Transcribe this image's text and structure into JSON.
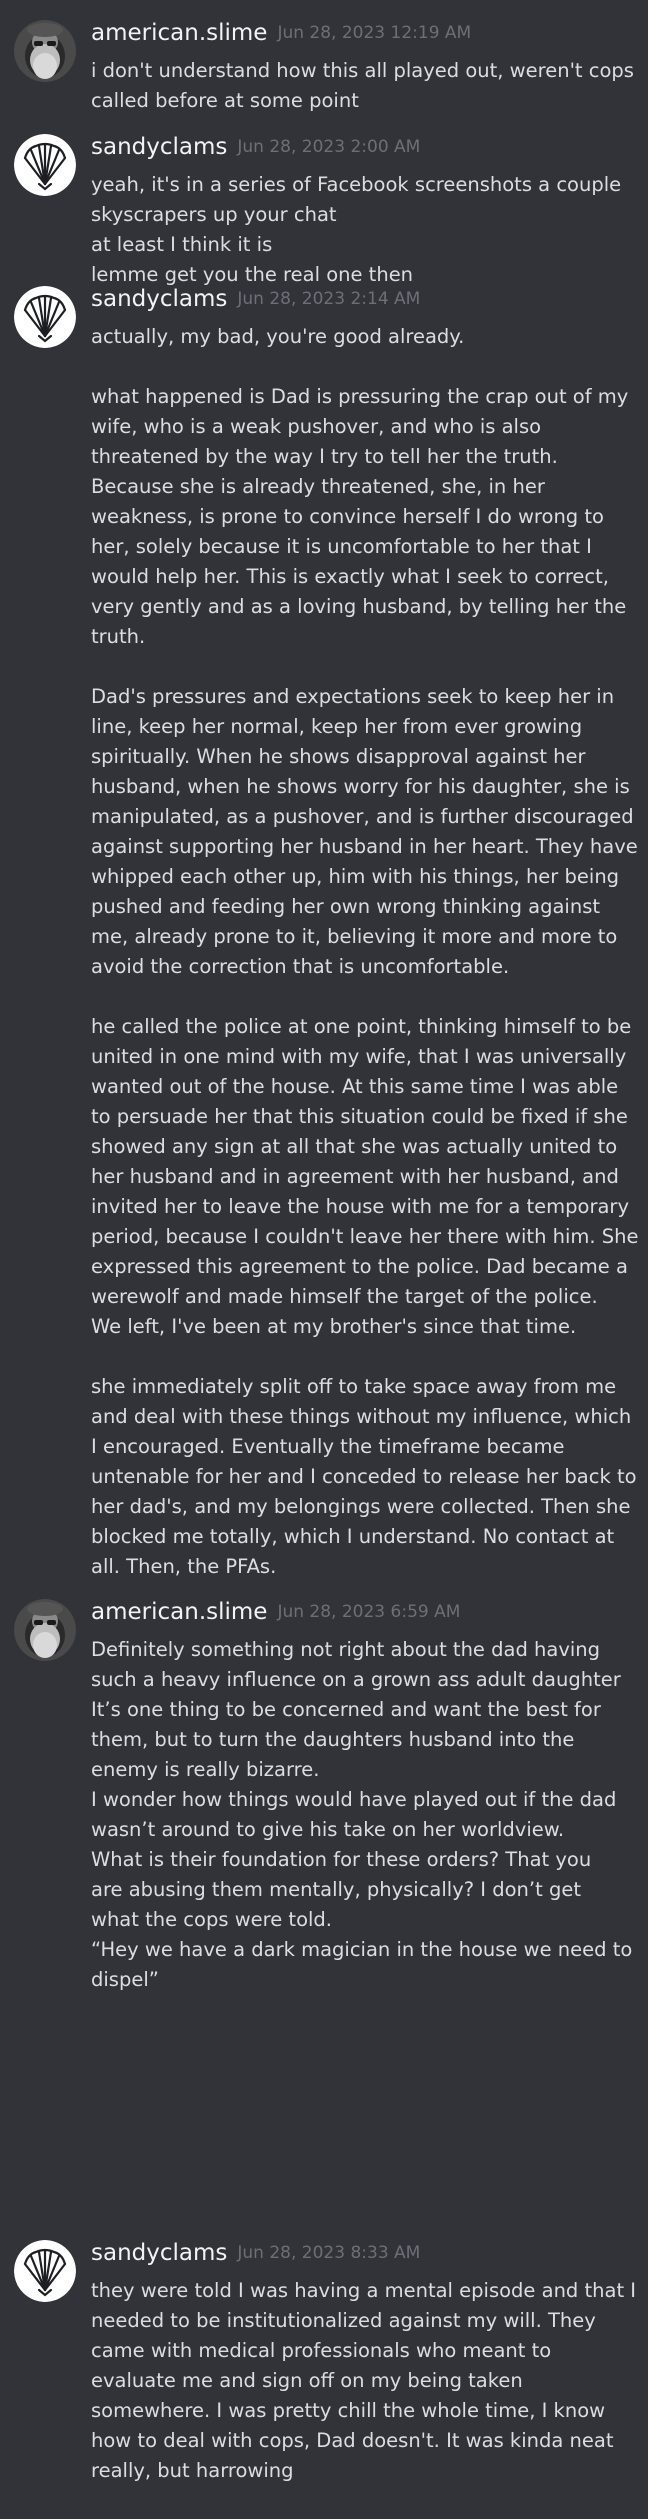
{
  "messages": [
    {
      "author": "american.slime",
      "avatar": "american-slime-avatar",
      "timestamp": "Jun 28, 2023 12:19 AM",
      "lines": [
        "i don't understand how this all played out, weren't cops",
        "called before at some point"
      ]
    },
    {
      "author": "sandyclams",
      "avatar": "shell-avatar",
      "timestamp": "Jun 28, 2023 2:00 AM",
      "lines": [
        "yeah, it's in a series of Facebook screenshots a couple",
        "skyscrapers up your chat",
        "at least I think it is",
        "lemme get you the real one then"
      ]
    },
    {
      "author": "sandyclams",
      "avatar": "shell-avatar",
      "timestamp": "Jun 28, 2023 2:14 AM",
      "lines": [
        "actually, my bad, you're good already.",
        "",
        "what happened is Dad is pressuring the crap out of my",
        "wife, who is a weak pushover, and who is also",
        "threatened by the way I try to tell her the truth.",
        "Because she is already threatened, she, in her",
        "weakness, is prone to convince herself I do wrong to",
        "her, solely because it is uncomfortable to her that I",
        "would help her. This is exactly what I seek to correct,",
        "very gently and as a loving husband, by telling her the",
        "truth.",
        "",
        "Dad's pressures and expectations seek to keep her in",
        "line, keep her normal, keep her from ever growing",
        "spiritually. When he shows disapproval against her",
        "husband, when he shows worry for his daughter, she is",
        "manipulated, as a pushover, and is further discouraged",
        "against supporting her husband in her heart. They have",
        "whipped each other up, him with his things, her being",
        "pushed and feeding her own wrong thinking against",
        "me, already prone to it, believing it more and more to",
        "avoid the correction that is uncomfortable.",
        "",
        "he called the police at one point, thinking himself to be",
        "united in one mind with my wife, that I was universally",
        "wanted out of the house. At this same time I was able",
        "to persuade her that this situation could be fixed if she",
        "showed any sign at all that she was actually united to",
        "her husband and in agreement with her husband, and",
        "invited her to leave the house with me for a temporary",
        "period, because I couldn't leave her there with him. She",
        "expressed this agreement to the police. Dad became a",
        "werewolf and made himself the target of the police.",
        "We left, I've been at my brother's since that time.",
        "",
        "she immediately split off to take space away from me",
        "and deal with these things without my influence, which",
        "I encouraged. Eventually the timeframe became",
        "untenable for her and I conceded to release her back to",
        "her dad's, and my belongings were collected. Then she",
        "blocked me totally, which I understand. No contact at",
        "all. Then, the PFAs."
      ]
    },
    {
      "author": "american.slime",
      "avatar": "american-slime-avatar",
      "timestamp": "Jun 28, 2023 6:59 AM",
      "lines": [
        "Definitely something not right about the dad having",
        "such a heavy influence on a grown ass adult daughter",
        "It’s one thing to be concerned and want the best for",
        "them, but to turn the daughters husband into the",
        "enemy is really bizarre.",
        "I wonder how things would have played out if the dad",
        "wasn’t around to give his take on her worldview.",
        "What is their foundation for these orders? That you",
        "are abusing them mentally, physically? I don’t get",
        "what the cops were told.",
        "“Hey we have a dark magician in the house we need to",
        "dispel”"
      ]
    },
    {
      "author": "sandyclams",
      "avatar": "shell-avatar",
      "timestamp": "Jun 28, 2023 8:33 AM",
      "lines": [
        "they were told I was having a mental episode and that I",
        "needed to be institutionalized against my will. They",
        "came with medical professionals who meant to",
        "evaluate me and sign off on my being taken",
        "somewhere. I was pretty chill the whole time, I know",
        "how to deal with cops, Dad doesn't. It was kinda neat",
        "really, but harrowing"
      ]
    }
  ]
}
